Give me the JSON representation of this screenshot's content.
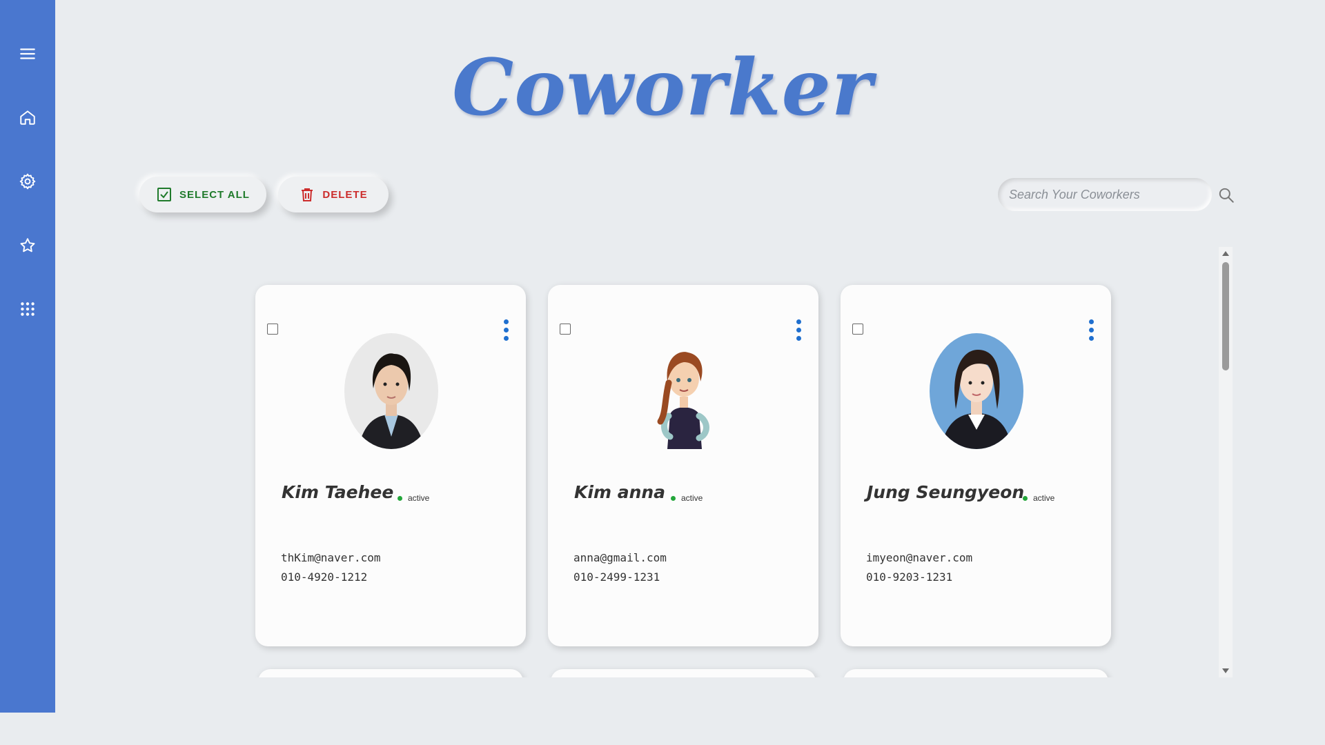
{
  "app": {
    "title": "Coworker"
  },
  "sidebar": {
    "items": [
      {
        "name": "menu",
        "icon": "hamburger-menu-icon"
      },
      {
        "name": "home",
        "icon": "home-icon"
      },
      {
        "name": "settings",
        "icon": "gear-icon"
      },
      {
        "name": "favorites",
        "icon": "star-icon"
      },
      {
        "name": "apps",
        "icon": "grid-icon"
      }
    ],
    "color": "#4a77cf"
  },
  "toolbar": {
    "select_all_label": "SELECT ALL",
    "delete_label": "DELETE"
  },
  "search": {
    "placeholder": "Search Your Coworkers",
    "value": ""
  },
  "coworkers": [
    {
      "name": "Kim Taehee",
      "status": "active",
      "email": "thKim@naver.com",
      "phone": "010-4920-1212"
    },
    {
      "name": "Kim anna",
      "status": "active",
      "email": "anna@gmail.com",
      "phone": "010-2499-1231"
    },
    {
      "name": "Jung Seungyeon",
      "status": "active",
      "email": "imyeon@naver.com",
      "phone": "010-9203-1231"
    }
  ],
  "colors": {
    "accent": "#4a79cc",
    "select_all": "#1f7a2b",
    "delete": "#cc2c2c",
    "status_active": "#23a63a",
    "menu_dots": "#1f6fcf"
  }
}
